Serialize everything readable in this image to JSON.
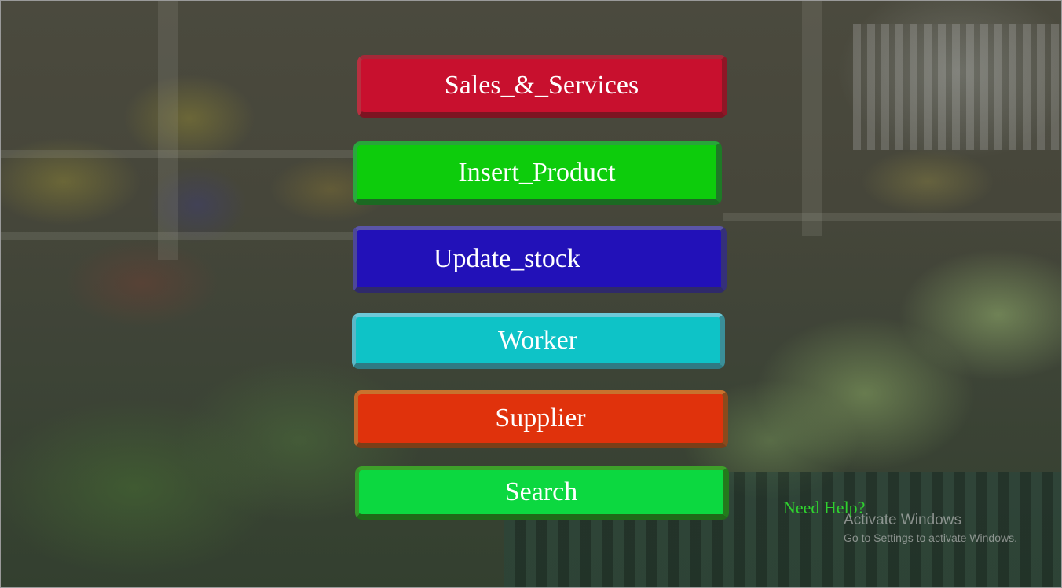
{
  "menu": {
    "sales_services": "Sales_&_Services",
    "insert_product": "Insert_Product",
    "update_stock": "Update_stock",
    "worker": "Worker",
    "supplier": "Supplier",
    "search": "Search"
  },
  "help_link": "Need Help?",
  "watermark": {
    "title": "Activate Windows",
    "subtitle": "Go to Settings to activate Windows."
  },
  "colors": {
    "sales_services": "#c8102e",
    "insert_product": "#0dcc0c",
    "update_stock": "#2211b8",
    "worker": "#0ec3c7",
    "supplier": "#e0320c",
    "search": "#0cd840",
    "help_link": "#2fd12f"
  }
}
